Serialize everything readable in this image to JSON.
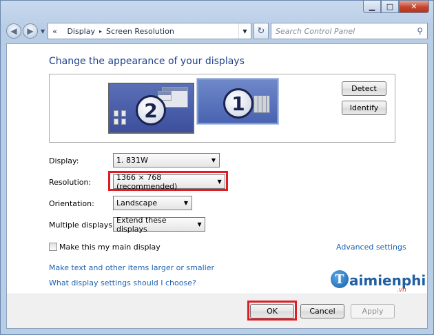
{
  "window": {
    "caption_buttons": {
      "minimize": "▁",
      "maximize": "□",
      "close": "✕"
    }
  },
  "navbar": {
    "back_icon": "◀",
    "forward_icon": "▶",
    "history_icon": "▼",
    "address": {
      "prefix": "«",
      "crumbs": [
        "Display",
        "Screen Resolution"
      ],
      "separator": "▸",
      "dropdown": "▼"
    },
    "refresh_icon": "↻",
    "search_placeholder": "Search Control Panel",
    "search_icon": "⚲"
  },
  "content": {
    "title": "Change the appearance of your displays",
    "monitors": [
      {
        "number": "2"
      },
      {
        "number": "1"
      }
    ],
    "detect_label": "Detect",
    "identify_label": "Identify",
    "settings": {
      "display": {
        "label": "Display:",
        "value": "1. 831W"
      },
      "resolution": {
        "label": "Resolution:",
        "value": "1366 × 768 (recommended)"
      },
      "orientation": {
        "label": "Orientation:",
        "value": "Landscape"
      },
      "multiple": {
        "label": "Multiple displays:",
        "value": "Extend these displays"
      }
    },
    "combo_arrow": "▼",
    "main_display_label": "Make this my main display",
    "advanced_link": "Advanced settings",
    "links": [
      "Make text and other items larger or smaller",
      "What display settings should I choose?"
    ],
    "watermark": {
      "initial": "T",
      "text": "aimienphi",
      "suffix": ".vn"
    }
  },
  "footer": {
    "ok_label": "OK",
    "cancel_label": "Cancel",
    "apply_label": "Apply"
  },
  "colors": {
    "title": "#1e3f8a",
    "link": "#1c62b0",
    "highlight": "#e31b23"
  }
}
